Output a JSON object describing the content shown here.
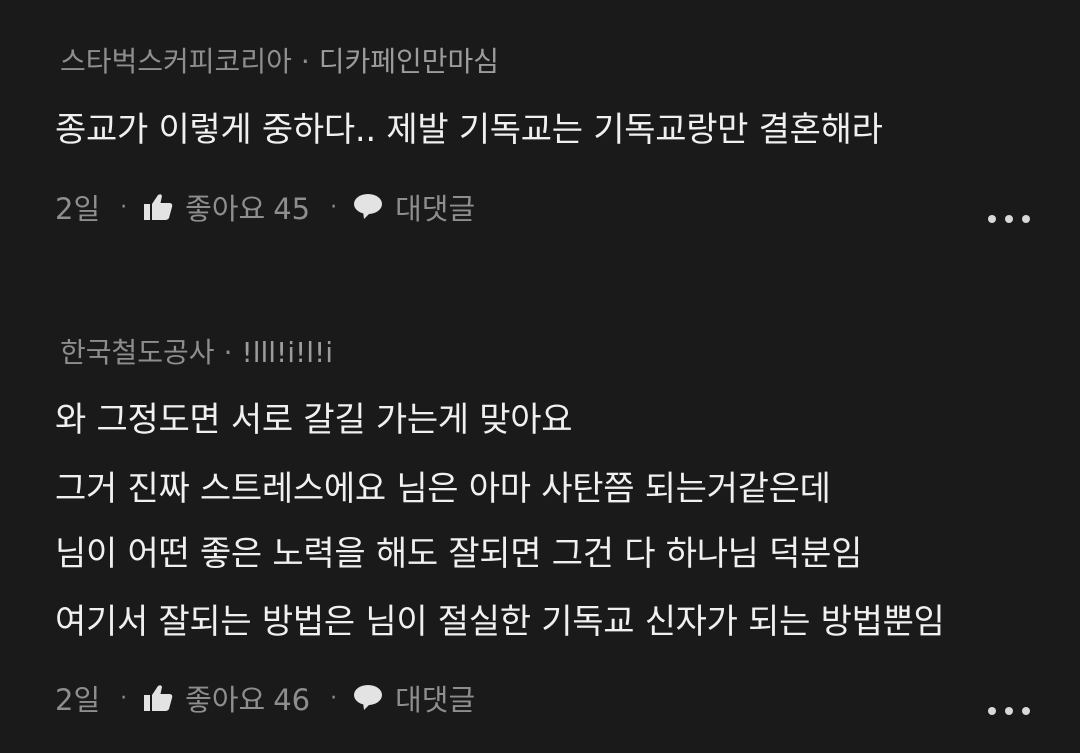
{
  "comments": [
    {
      "author": "스타벅스커피코리아",
      "separator": "·",
      "nickname": "디카페인만마심",
      "lines": [
        "종교가 이렇게 중하다.. 제발 기독교는 기독교랑만 결혼해라"
      ],
      "time": "2일",
      "like_label": "좋아요",
      "like_count": "45",
      "reply_label": "대댓글",
      "icons": {
        "like": "thumbs-up-icon",
        "reply": "speech-bubble-icon",
        "more": "more-options-icon"
      }
    },
    {
      "author": "한국철도공사",
      "separator": "·",
      "nickname": "!lll!i!l!i",
      "lines": [
        "와 그정도면 서로 갈길 가는게 맞아요",
        "그거 진짜 스트레스에요 님은 아마 사탄쯤 되는거같은데",
        "님이 어떤 좋은 노력을 해도 잘되면 그건 다 하나님 덕분임",
        "여기서 잘되는 방법은 님이 절실한 기독교 신자가 되는 방법뿐임"
      ],
      "time": "2일",
      "like_label": "좋아요",
      "like_count": "46",
      "reply_label": "대댓글",
      "icons": {
        "like": "thumbs-up-icon",
        "reply": "speech-bubble-icon",
        "more": "more-options-icon"
      }
    }
  ],
  "colors": {
    "background": "#1a1a1a",
    "text_primary": "#f0f0f0",
    "text_secondary": "#8e8e8e"
  }
}
